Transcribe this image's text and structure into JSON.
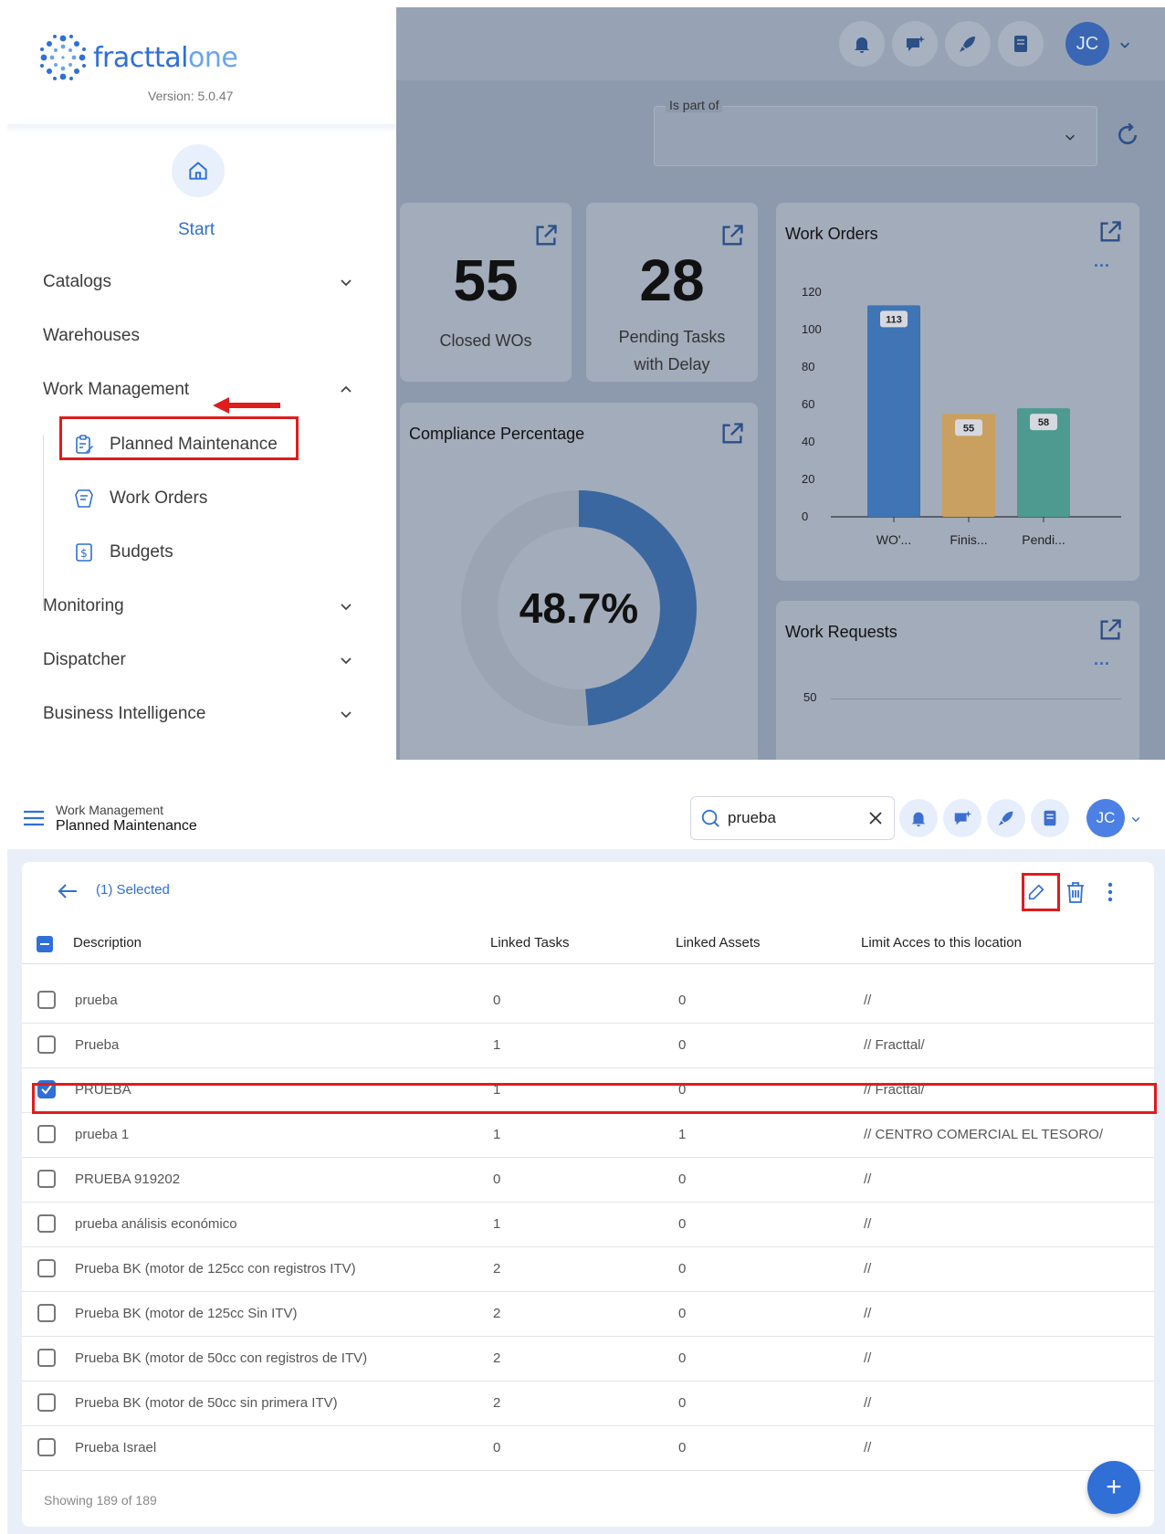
{
  "top": {
    "logo": {
      "part1": "fracttal",
      "part2": "one"
    },
    "version": "Version: 5.0.47",
    "start_label": "Start",
    "nav": [
      {
        "label": "Catalogs"
      },
      {
        "label": "Warehouses"
      },
      {
        "label": "Work Management"
      },
      {
        "label": "Monitoring"
      },
      {
        "label": "Dispatcher"
      },
      {
        "label": "Business Intelligence"
      }
    ],
    "submenu": [
      {
        "label": "Planned Maintenance"
      },
      {
        "label": "Work Orders"
      },
      {
        "label": "Budgets"
      }
    ],
    "dashboard": {
      "avatar": "JC",
      "filter_label": "Is part of",
      "closed_wos": {
        "value": "55",
        "label": "Closed WOs"
      },
      "pending_tasks": {
        "value": "28",
        "label": "Pending Tasks with Delay"
      },
      "compliance": {
        "title": "Compliance Percentage",
        "value": "48.7%",
        "fraction": 0.487
      },
      "work_orders_title": "Work Orders",
      "work_requests_title": "Work Requests",
      "work_requests_tick": "50",
      "menu_dots": "..."
    }
  },
  "chart_data": {
    "type": "bar",
    "title": "Work Orders",
    "categories": [
      "WO'...",
      "Finis...",
      "Pendi..."
    ],
    "values": [
      113,
      55,
      58
    ],
    "ylim": [
      0,
      120
    ],
    "yticks": [
      "0",
      "20",
      "40",
      "60",
      "80",
      "100",
      "120"
    ],
    "colors": [
      "#3f74b5",
      "#c9a060",
      "#4e9990"
    ]
  },
  "bottom": {
    "breadcrumb_parent": "Work Management",
    "page_title": "Planned Maintenance",
    "search_value": "prueba",
    "avatar": "JC",
    "selected_text": "(1) Selected",
    "columns": [
      "Description",
      "Linked Tasks",
      "Linked Assets",
      "Limit Acces to this location"
    ],
    "rows": [
      {
        "desc": "prueba",
        "tasks": "0",
        "assets": "0",
        "loc": "//"
      },
      {
        "desc": "Prueba",
        "tasks": "1",
        "assets": "0",
        "loc": "// Fracttal/"
      },
      {
        "desc": "PRUEBA",
        "tasks": "1",
        "assets": "0",
        "loc": "// Fracttal/"
      },
      {
        "desc": "prueba 1",
        "tasks": "1",
        "assets": "1",
        "loc": "// CENTRO COMERCIAL EL TESORO/"
      },
      {
        "desc": "PRUEBA 919202",
        "tasks": "0",
        "assets": "0",
        "loc": "//"
      },
      {
        "desc": "prueba análisis económico",
        "tasks": "1",
        "assets": "0",
        "loc": "//"
      },
      {
        "desc": "Prueba BK (motor de 125cc con registros ITV)",
        "tasks": "2",
        "assets": "0",
        "loc": "//"
      },
      {
        "desc": "Prueba BK (motor de 125cc Sin ITV)",
        "tasks": "2",
        "assets": "0",
        "loc": "//"
      },
      {
        "desc": "Prueba BK (motor de 50cc con registros de ITV)",
        "tasks": "2",
        "assets": "0",
        "loc": "//"
      },
      {
        "desc": "Prueba BK (motor de 50cc sin primera ITV)",
        "tasks": "2",
        "assets": "0",
        "loc": "//"
      },
      {
        "desc": "Prueba Israel",
        "tasks": "0",
        "assets": "0",
        "loc": "//"
      }
    ],
    "footer": "Showing 189 of 189",
    "fab": "+"
  }
}
